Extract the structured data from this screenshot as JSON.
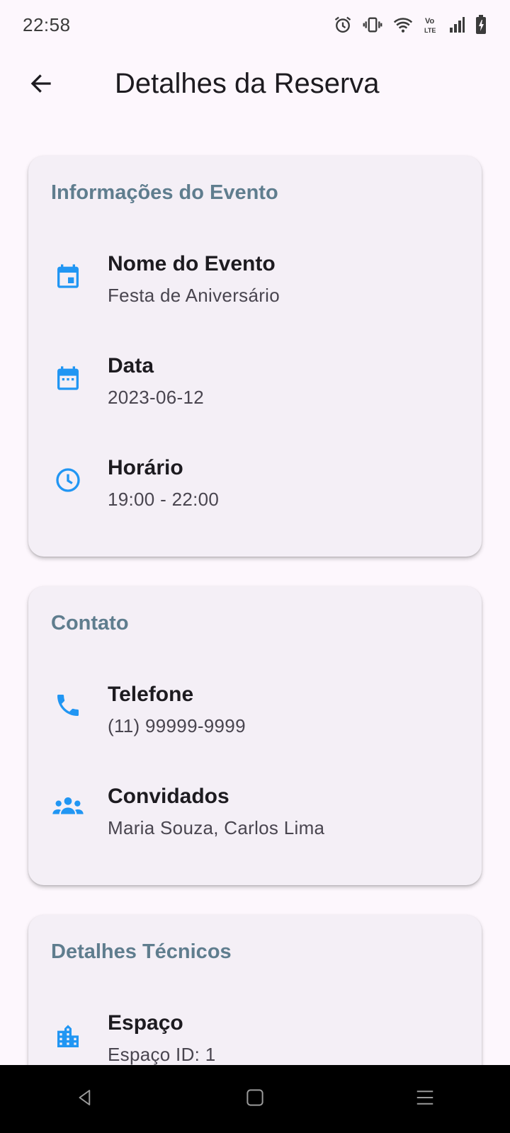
{
  "status_bar": {
    "time": "22:58",
    "icons": [
      "alarm-icon",
      "vibrate-icon",
      "wifi-icon",
      "volte-icon",
      "signal-icon",
      "battery-charging-icon"
    ]
  },
  "app_bar": {
    "title": "Detalhes da Reserva",
    "back_icon": "arrow-back-icon"
  },
  "colors": {
    "background": "#fdf7fd",
    "card": "#f4eff6",
    "section_title": "#5f7d8e",
    "icon_accent": "#2196f3",
    "label": "#1d1b20",
    "value": "#49454f"
  },
  "sections": [
    {
      "title": "Informações do Evento",
      "rows": [
        {
          "icon": "event-icon",
          "label": "Nome do Evento",
          "value": "Festa de Aniversário"
        },
        {
          "icon": "calendar-icon",
          "label": "Data",
          "value": "2023-06-12"
        },
        {
          "icon": "clock-icon",
          "label": "Horário",
          "value": "19:00 - 22:00"
        }
      ]
    },
    {
      "title": "Contato",
      "rows": [
        {
          "icon": "phone-icon",
          "label": "Telefone",
          "value": "(11) 99999-9999"
        },
        {
          "icon": "people-icon",
          "label": "Convidados",
          "value": "Maria Souza, Carlos Lima"
        }
      ]
    },
    {
      "title": "Detalhes Técnicos",
      "rows": [
        {
          "icon": "building-icon",
          "label": "Espaço",
          "value": "Espaço ID: 1"
        }
      ]
    }
  ],
  "nav_bar": {
    "icons": [
      "nav-back-icon",
      "nav-home-icon",
      "nav-recents-icon"
    ]
  }
}
